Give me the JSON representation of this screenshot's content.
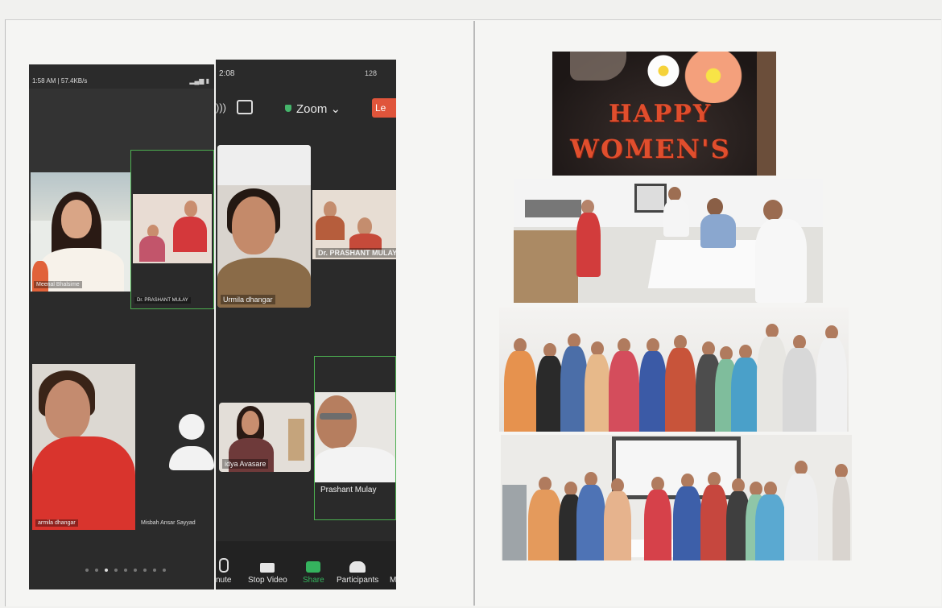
{
  "left": {
    "shot1": {
      "status_time": "1:58 AM | 57.4KB/s",
      "tiles": [
        {
          "name": "Meenal Bhalsime"
        },
        {
          "name": "Dr. PRASHANT MULAY"
        },
        {
          "name": "armila dhangar"
        },
        {
          "name": "Misbah Ansar Sayyad"
        }
      ]
    },
    "shot2": {
      "status_time": "2:08",
      "status_right": "128",
      "title": "Zoom",
      "leave_label": "Le",
      "tiles": [
        {
          "name": "Urmila dhangar"
        },
        {
          "name": "Dr. PRASHANT MULAY"
        },
        {
          "name": "idya Avasare"
        },
        {
          "name": "Prashant Mulay"
        }
      ],
      "toolbar": [
        {
          "label": "nute"
        },
        {
          "label": "Stop Video"
        },
        {
          "label": "Share"
        },
        {
          "label": "Participants"
        },
        {
          "label": "M"
        }
      ]
    }
  },
  "right": {
    "cake": {
      "line1": "HAPPY",
      "line2": "WOMEN'S"
    }
  },
  "colors": {
    "zoom_bg": "#2b2b2b",
    "active_speaker": "#4caf50",
    "leave": "#e0553b",
    "share": "#35b35e",
    "cake_text": "#e04e2d"
  }
}
